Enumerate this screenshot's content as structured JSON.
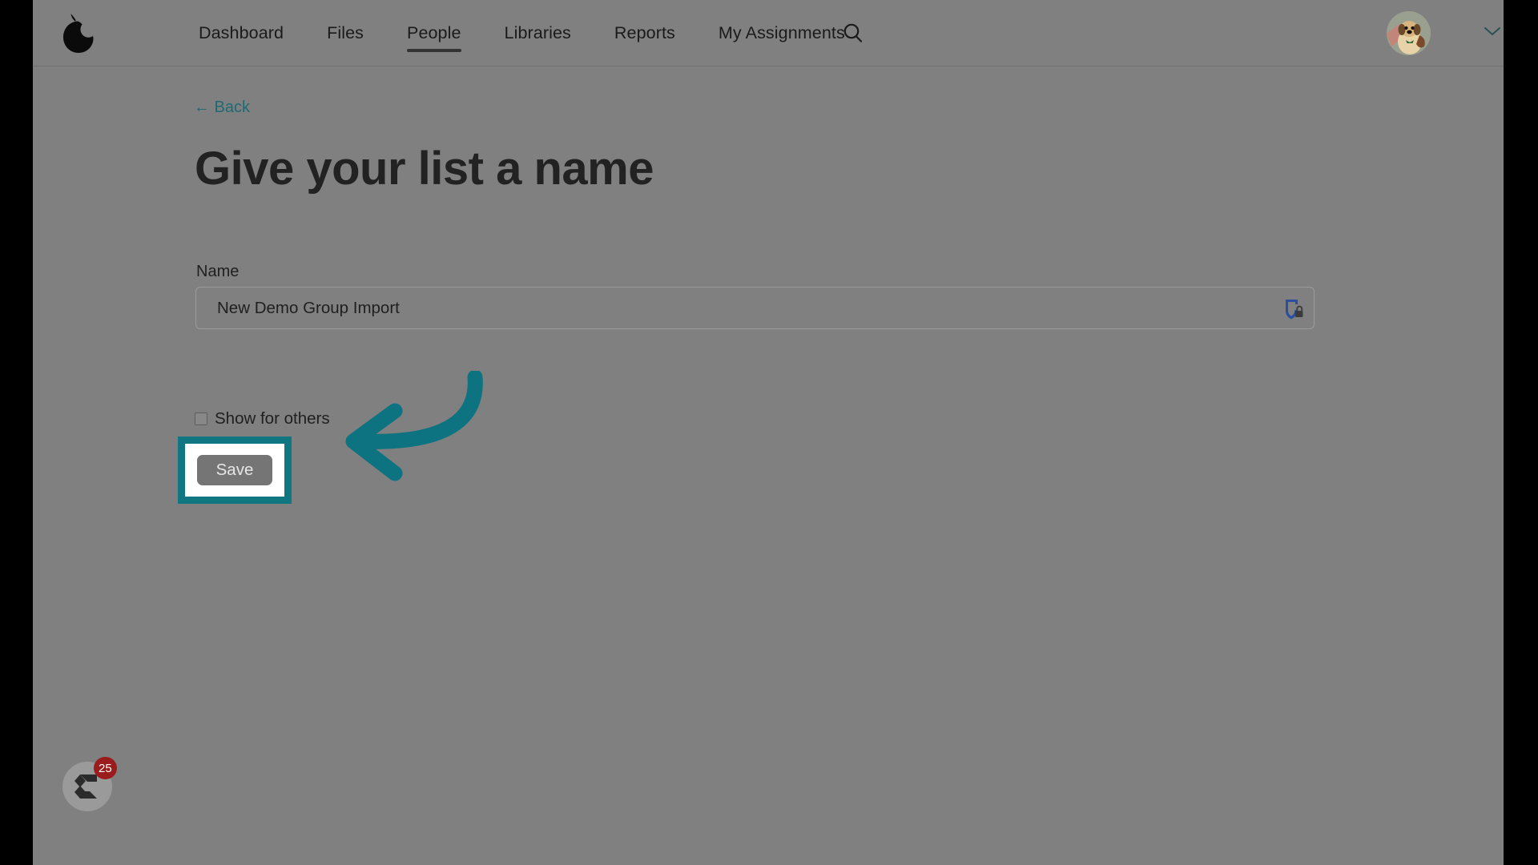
{
  "app": {
    "brand_icon": "pear-logo-icon",
    "background_color": "#808080",
    "accent_color": "#107681",
    "link_color": "#1f6a72"
  },
  "topnav": {
    "links": [
      {
        "label": "Dashboard",
        "active": false
      },
      {
        "label": "Files",
        "active": false
      },
      {
        "label": "People",
        "active": true
      },
      {
        "label": "Libraries",
        "active": false
      },
      {
        "label": "Reports",
        "active": false
      },
      {
        "label": "My Assignments",
        "active": false
      }
    ],
    "search_icon": "search-icon",
    "avatar_icon": "user-avatar-dog-photo",
    "caret_icon": "chevron-down-icon"
  },
  "content": {
    "back_link": "← Back",
    "title": "Give your list a name",
    "field_label": "Name",
    "name_value": "New Demo Group Import",
    "name_placeholder": "",
    "password_manager_icon": "shield-lock-icon",
    "checkbox_label": "Show for others",
    "checkbox_checked": false,
    "save_label": "Save"
  },
  "annotation": {
    "arrow_icon": "curved-left-arrow-icon",
    "highlight_target": "save-button"
  },
  "help_widget": {
    "icon": "chat-help-icon",
    "badge_count": "25"
  }
}
